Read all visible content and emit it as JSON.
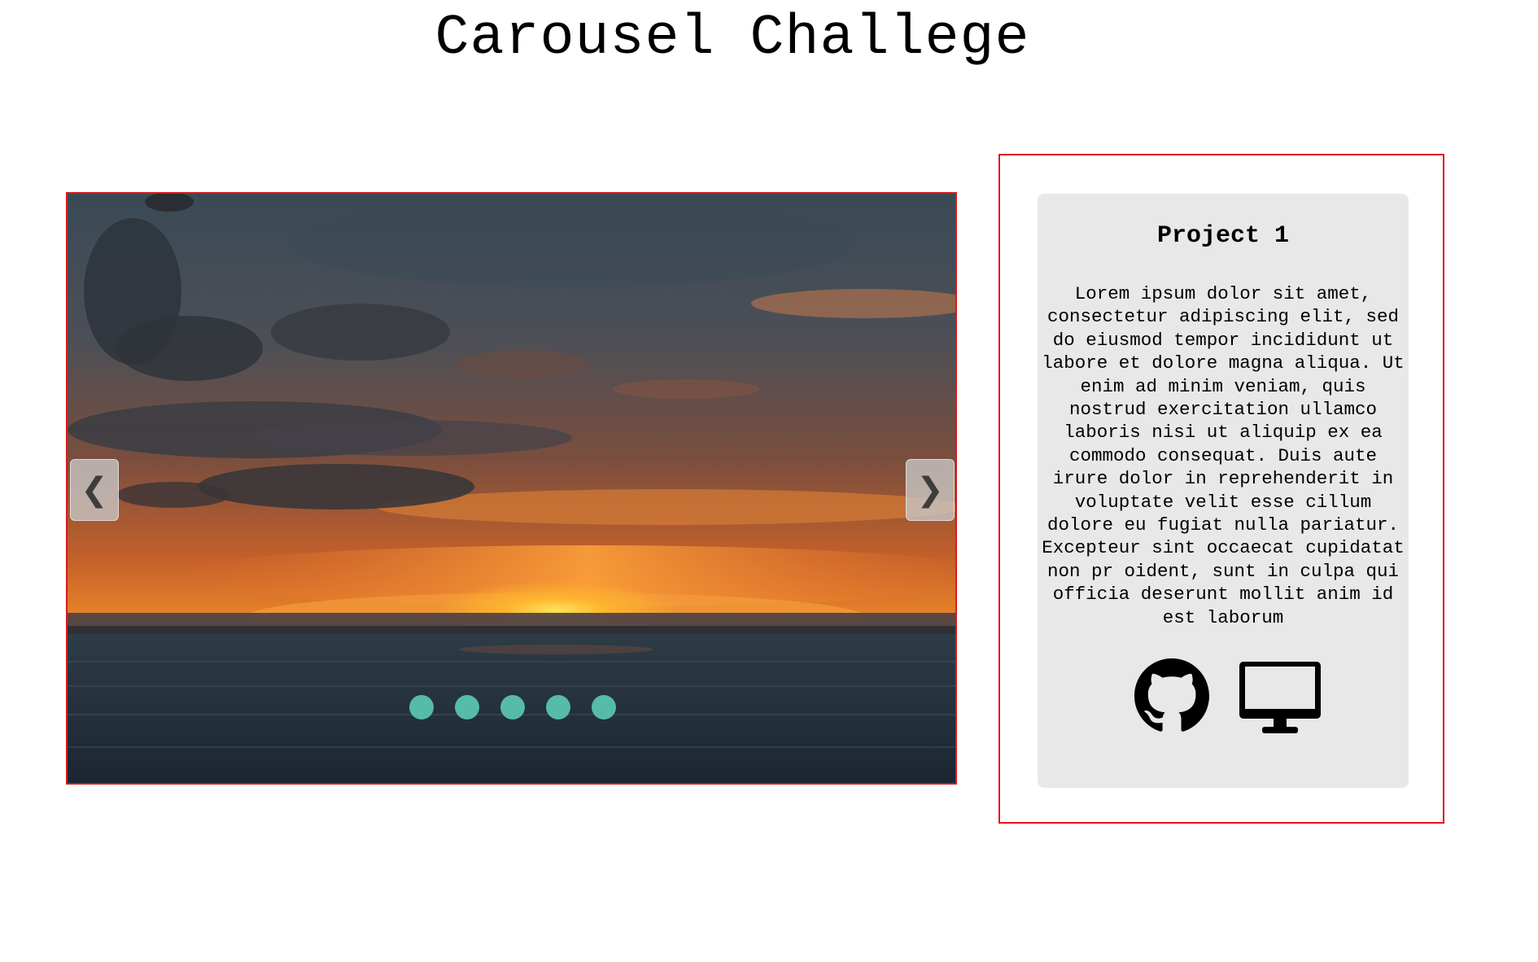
{
  "page": {
    "title": "Carousel Challege"
  },
  "carousel": {
    "prev_icon": "chevron-left-icon",
    "prev_glyph": "❮",
    "next_icon": "chevron-right-icon",
    "next_glyph": "❯",
    "slide_image": "sunset-over-ocean",
    "dot_count": 5,
    "dot_color": "#56bba8",
    "border_color": "#d81b1b"
  },
  "project": {
    "title": "Project 1",
    "description": "Lorem ipsum dolor sit amet, consectetur adipiscing elit, sed do eiusmod tempor incididunt ut labore et dolore magna aliqua. Ut enim ad minim veniam, quis nostrud exercitation ullamco laboris nisi ut aliquip ex ea commodo consequat. Duis aute irure dolor in reprehenderit in voluptate velit esse cillum dolore eu fugiat nulla pariatur. Excepteur sint occaecat cupidatat non pr oident, sunt in culpa qui officia deserunt mollit anim id est laborum",
    "links": [
      {
        "icon": "github-icon"
      },
      {
        "icon": "desktop-icon"
      }
    ],
    "card_background": "#e8e8e8",
    "frame_border_color": "#e0151f"
  }
}
